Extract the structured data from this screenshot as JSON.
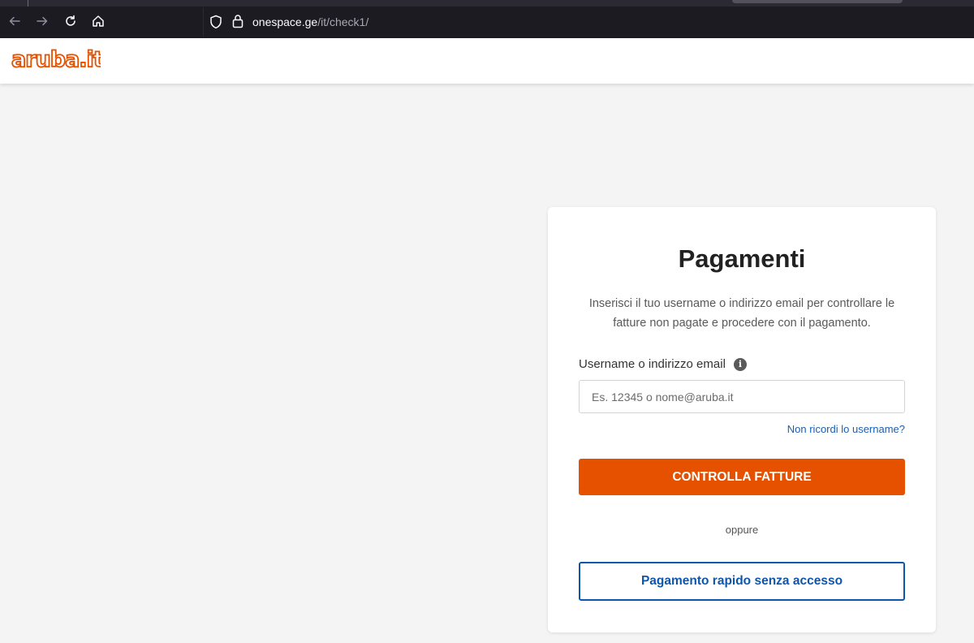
{
  "browser": {
    "url_domain": "onespace.ge",
    "url_path": "/it/check1/",
    "icons": [
      "back-arrow-icon",
      "forward-arrow-icon",
      "reload-icon",
      "home-icon",
      "shield-icon",
      "lock-icon"
    ]
  },
  "header": {
    "logo_text": "aruba.it",
    "brand_color": "#e65100"
  },
  "card": {
    "title": "Pagamenti",
    "description": "Inserisci il tuo username o indirizzo email per controllare le fatture non pagate e procedere con il pagamento.",
    "field_label": "Username o indirizzo email",
    "info_glyph": "i",
    "input_placeholder": "Es. 12345 o nome@aruba.it",
    "input_value": "",
    "forgot_link": "Non ricordi lo username?",
    "primary_button": "CONTROLLA FATTURE",
    "or_text": "oppure",
    "secondary_button": "Pagamento rapido senza accesso"
  },
  "colors": {
    "primary": "#e65100",
    "link": "#1a5fb4",
    "secondary_border": "#0d56b0",
    "background": "#f4f4f4"
  }
}
